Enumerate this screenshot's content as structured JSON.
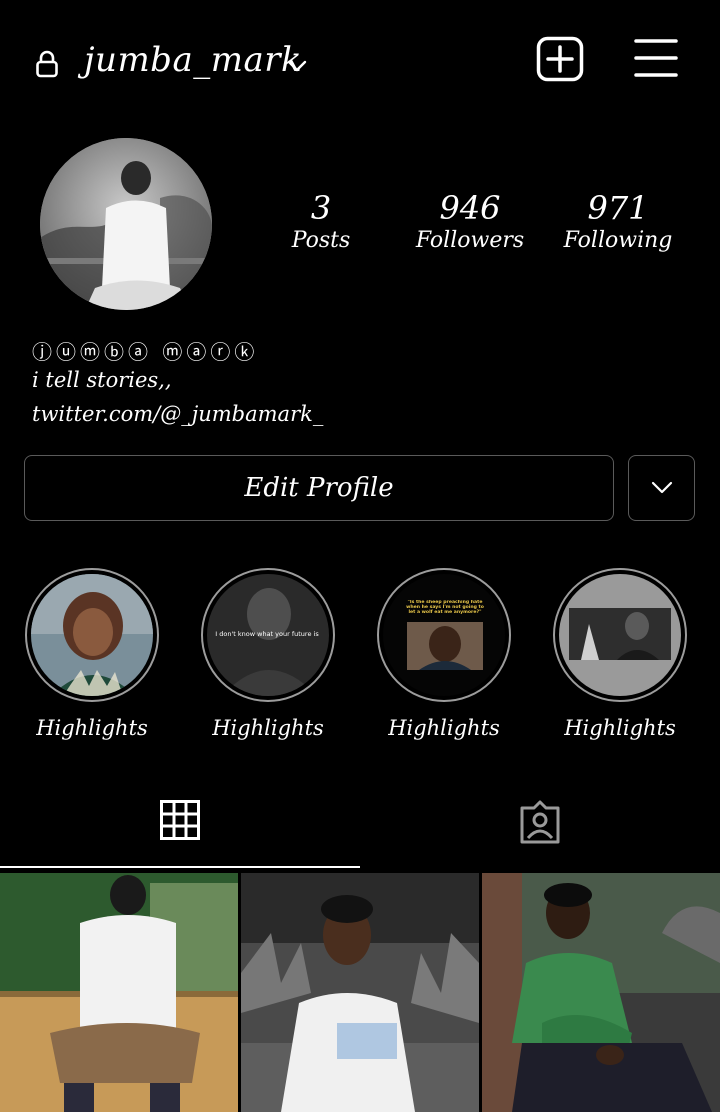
{
  "header": {
    "username": "jumba_mark",
    "icons": {
      "lock": "lock-icon",
      "chevron": "chevron-down-icon",
      "new_post": "plus-square-icon",
      "menu": "hamburger-menu-icon"
    }
  },
  "stats": {
    "posts": {
      "value": "3",
      "label": "Posts"
    },
    "followers": {
      "value": "946",
      "label": "Followers"
    },
    "following": {
      "value": "971",
      "label": "Following"
    }
  },
  "bio": {
    "display_name": "ⓙⓤⓜⓑⓐ ⓜⓐⓡⓚ",
    "text": "i tell stories,,",
    "link": "twitter.com/@_jumbamark_"
  },
  "actions": {
    "edit_profile": "Edit Profile"
  },
  "highlights": [
    {
      "label": "Highlights"
    },
    {
      "label": "Highlights",
      "caption": "I don't know what your future is"
    },
    {
      "label": "Highlights",
      "caption": "\"Is the sheep preaching hate when he says I'm not going to let a wolf eat me anymore?\""
    },
    {
      "label": "Highlights"
    }
  ],
  "tabs": [
    {
      "name": "grid-icon",
      "active": true
    },
    {
      "name": "tagged-person-icon",
      "active": false
    }
  ],
  "colors": {
    "background": "#000000",
    "text": "#ffffff",
    "border": "#5a5a5a",
    "ring": "#9c9c9c"
  }
}
